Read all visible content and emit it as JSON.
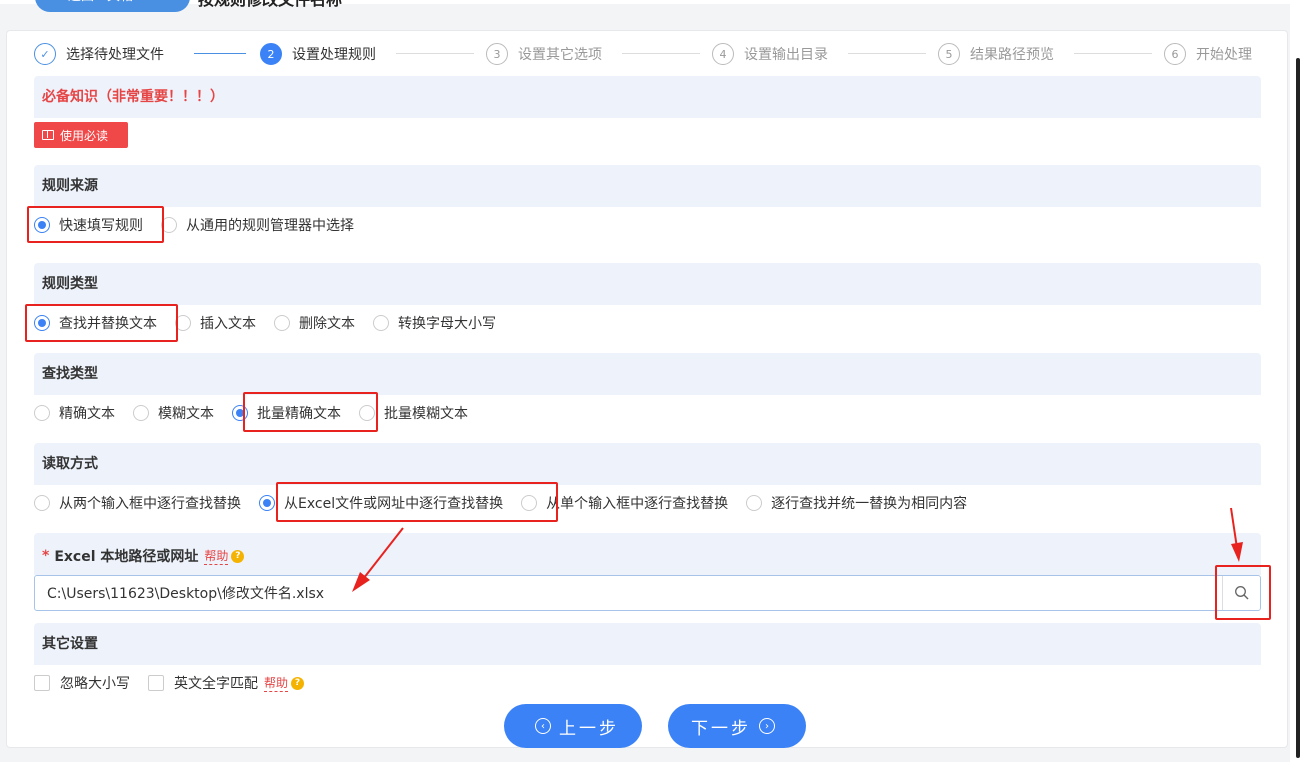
{
  "header": {
    "back_label": "< 返回工具箱",
    "title": "按规则修改文件名称"
  },
  "steps": [
    {
      "num": "✓",
      "label": "选择待处理文件",
      "state": "done"
    },
    {
      "num": "2",
      "label": "设置处理规则",
      "state": "active"
    },
    {
      "num": "3",
      "label": "设置其它选项",
      "state": "pending"
    },
    {
      "num": "4",
      "label": "设置输出目录",
      "state": "pending"
    },
    {
      "num": "5",
      "label": "结果路径预览",
      "state": "pending"
    },
    {
      "num": "6",
      "label": "开始处理",
      "state": "pending"
    }
  ],
  "knowledge": {
    "title": "必备知识（非常重要！！！）",
    "button": "使用必读"
  },
  "rule_source": {
    "title": "规则来源",
    "options": [
      "快速填写规则",
      "从通用的规则管理器中选择"
    ],
    "selected": 0
  },
  "rule_type": {
    "title": "规则类型",
    "options": [
      "查找并替换文本",
      "插入文本",
      "删除文本",
      "转换字母大小写"
    ],
    "selected": 0
  },
  "find_type": {
    "title": "查找类型",
    "options": [
      "精确文本",
      "模糊文本",
      "批量精确文本",
      "批量模糊文本"
    ],
    "selected": 2
  },
  "read_mode": {
    "title": "读取方式",
    "options": [
      "从两个输入框中逐行查找替换",
      "从Excel文件或网址中逐行查找替换",
      "从单个输入框中逐行查找替换",
      "逐行查找并统一替换为相同内容"
    ],
    "selected": 1
  },
  "excel_field": {
    "label": "Excel 本地路径或网址",
    "help": "帮助",
    "value": "C:\\Users\\11623\\Desktop\\修改文件名.xlsx"
  },
  "other": {
    "title": "其它设置",
    "options": [
      "忽略大小写",
      "英文全字匹配"
    ],
    "help": "帮助"
  },
  "nav": {
    "prev": "上一步",
    "next": "下一步"
  },
  "colors": {
    "primary": "#3b82f6",
    "danger": "#e64545",
    "annotation": "#e8231f"
  }
}
